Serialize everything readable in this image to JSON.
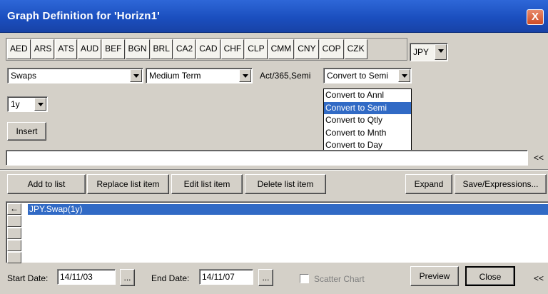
{
  "window": {
    "title": "Graph Definition for 'Horizn1'",
    "close_glyph": "X"
  },
  "currencies": [
    "AED",
    "ARS",
    "ATS",
    "AUD",
    "BEF",
    "BGN",
    "BRL",
    "CA2",
    "CAD",
    "CHF",
    "CLP",
    "CMM",
    "CNY",
    "COP",
    "CZK"
  ],
  "currency_select": {
    "value": "JPY"
  },
  "instrument_select": {
    "value": "Swaps"
  },
  "term_select": {
    "value": "Medium Term"
  },
  "daycount_label": "Act/365,Semi",
  "convert_select": {
    "value": "Convert to Semi",
    "options": [
      "Convert to Annl",
      "Convert to Semi",
      "Convert to Qtly",
      "Convert to Mnth",
      "Convert to Day"
    ]
  },
  "tenor_select": {
    "value": "1y"
  },
  "insert_button": "Insert",
  "expression_field": {
    "value": ""
  },
  "expand_arrows": "<<",
  "buttons": {
    "add_to_list": "Add to list",
    "replace_list_item": "Replace list item",
    "edit_list_item": "Edit list item",
    "delete_list_item": "Delete list item",
    "expand": "Expand",
    "save_expressions": "Save/Expressions..."
  },
  "list_items": [
    "JPY.Swap(1y)"
  ],
  "row_arrow": "←",
  "start_date": {
    "label": "Start Date:",
    "value": "14/11/03"
  },
  "end_date": {
    "label": "End Date:",
    "value": "14/11/07"
  },
  "ellipsis": "...",
  "scatter_chart": {
    "label": "Scatter Chart",
    "checked": false
  },
  "preview_button": "Preview",
  "close_button": "Close",
  "bottom_arrows": "<<"
}
